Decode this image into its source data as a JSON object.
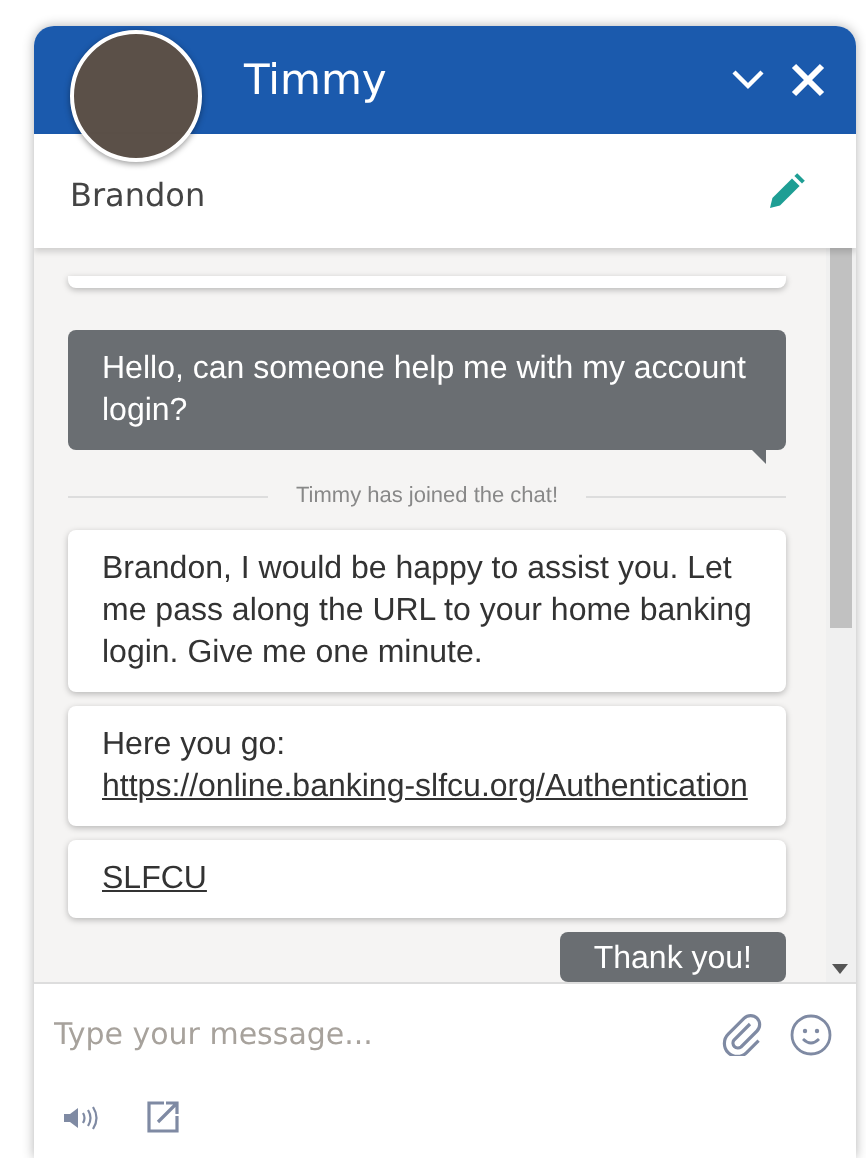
{
  "header": {
    "agent_name": "Timmy"
  },
  "visitor": {
    "name": "Brandon"
  },
  "messages": [
    {
      "kind": "fragment"
    },
    {
      "kind": "visitor",
      "text": "Hello, can someone help me with my account login?"
    },
    {
      "kind": "system",
      "text": "Timmy has joined the chat!"
    },
    {
      "kind": "agent",
      "text": "Brandon, I would be happy to assist you.  Let me pass along the URL to your home banking login.  Give me one minute."
    },
    {
      "kind": "agent",
      "text": "Here you go: ",
      "link": "https://online.banking-slfcu.org/Authentication"
    },
    {
      "kind": "agent",
      "link": "SLFCU"
    },
    {
      "kind": "visitor",
      "text": "Thank you!"
    }
  ],
  "composer": {
    "placeholder": "Type your message..."
  }
}
